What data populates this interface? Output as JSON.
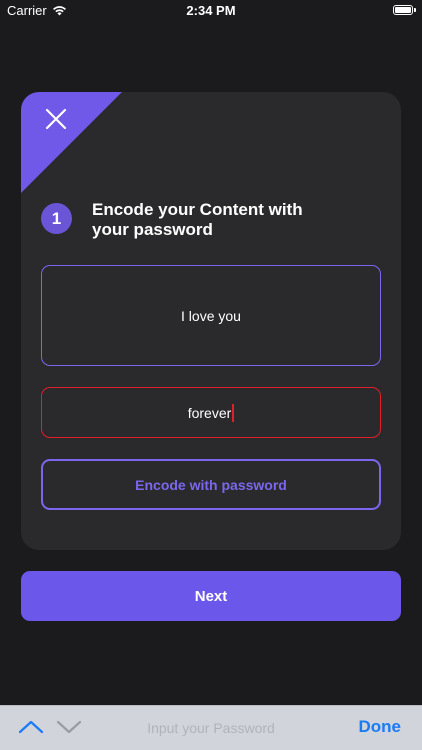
{
  "status_bar": {
    "carrier": "Carrier",
    "time": "2:34 PM",
    "wifi_icon": "wifi-icon",
    "battery_icon": "battery-icon",
    "battery_level": 1.0
  },
  "card": {
    "close_icon": "close-icon",
    "step_number": "1",
    "title": "Encode your Content with\nyour password",
    "content_value": "I love you",
    "password_value": "forever",
    "encode_button_label": "Encode with password"
  },
  "next_button_label": "Next",
  "keyboard_toolbar": {
    "up_icon": "chevron-up-icon",
    "down_icon": "chevron-down-icon",
    "placeholder": "Input your Password",
    "done_label": "Done"
  },
  "colors": {
    "background": "#1b1b1d",
    "card": "#2a2a2d",
    "accent": "#6b57e9",
    "error": "#e11f28",
    "link": "#1a7bf5"
  }
}
